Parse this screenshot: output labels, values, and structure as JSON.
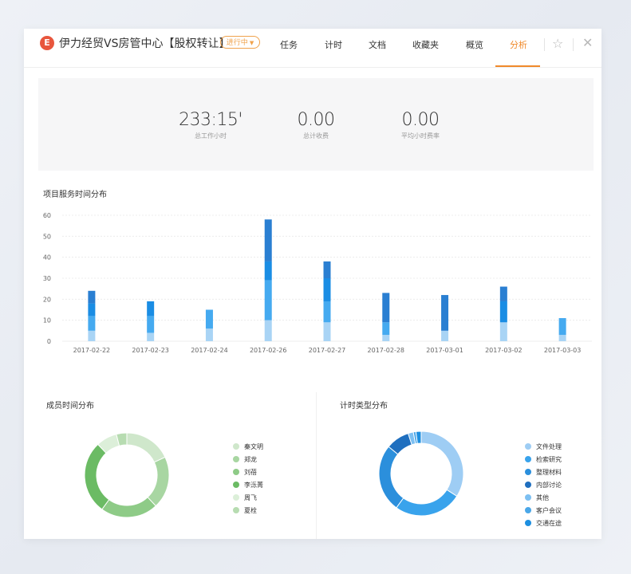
{
  "header": {
    "logo": "E",
    "title": "伊力经贸VS房管中心【股权转让】",
    "status": "进行中",
    "tabs": [
      "任务",
      "计时",
      "文档",
      "收藏夹",
      "概览",
      "分析"
    ],
    "active_tab": "分析"
  },
  "summary": {
    "total_hours": {
      "value": "233:15'",
      "label": "总工作小时"
    },
    "total_fee": {
      "value": "0.00",
      "label": "总计收费"
    },
    "avg_rate": {
      "value": "0.00",
      "label": "平均小时费率"
    }
  },
  "service_chart_title": "项目服务时间分布",
  "member_chart_title": "成员时间分布",
  "type_chart_title": "计时类型分布",
  "chart_data": [
    {
      "type": "bar",
      "title": "项目服务时间分布",
      "categories": [
        "2017-02-22",
        "2017-02-23",
        "2017-02-24",
        "2017-02-26",
        "2017-02-27",
        "2017-02-28",
        "2017-03-01",
        "2017-03-02",
        "2017-03-03"
      ],
      "series": [
        {
          "values": [
            5,
            4,
            6,
            10,
            9,
            3,
            5,
            9,
            3
          ]
        },
        {
          "values": [
            7,
            8,
            9,
            19,
            10,
            6,
            0,
            0,
            8
          ]
        },
        {
          "values": [
            6,
            7,
            0,
            9,
            11,
            0,
            0,
            10,
            0
          ]
        },
        {
          "values": [
            6,
            0,
            0,
            20,
            8,
            14,
            17,
            7,
            0
          ]
        }
      ],
      "series_colors": [
        "#a9d4f5",
        "#45aaf0",
        "#1a8de4",
        "#2a7fd2"
      ],
      "ylim": [
        0,
        60
      ],
      "yticks": [
        0,
        10,
        20,
        30,
        40,
        50,
        60
      ],
      "grid": true
    },
    {
      "type": "pie",
      "title": "成员时间分布",
      "labels": [
        "秦文明",
        "郑龙",
        "刘蓓",
        "李泺菁",
        "周飞",
        "夏栓"
      ],
      "values": [
        18,
        20,
        22,
        28,
        8,
        4
      ],
      "colors": [
        "#cfe7cb",
        "#a8d6a2",
        "#8ecb87",
        "#6bbb64",
        "#dcefd9",
        "#b7dcb1"
      ]
    },
    {
      "type": "pie",
      "title": "计时类型分布",
      "labels": [
        "文件处理",
        "检索研究",
        "整理材料",
        "内部讨论",
        "其他",
        "客户会议",
        "交通在途"
      ],
      "values": [
        34,
        26,
        26,
        9,
        2,
        1,
        2
      ],
      "colors": [
        "#9ecdf4",
        "#39a3ec",
        "#2b8fdc",
        "#1f6fbf",
        "#7dc0f2",
        "#4aa7e8",
        "#1d8fe0"
      ]
    }
  ]
}
